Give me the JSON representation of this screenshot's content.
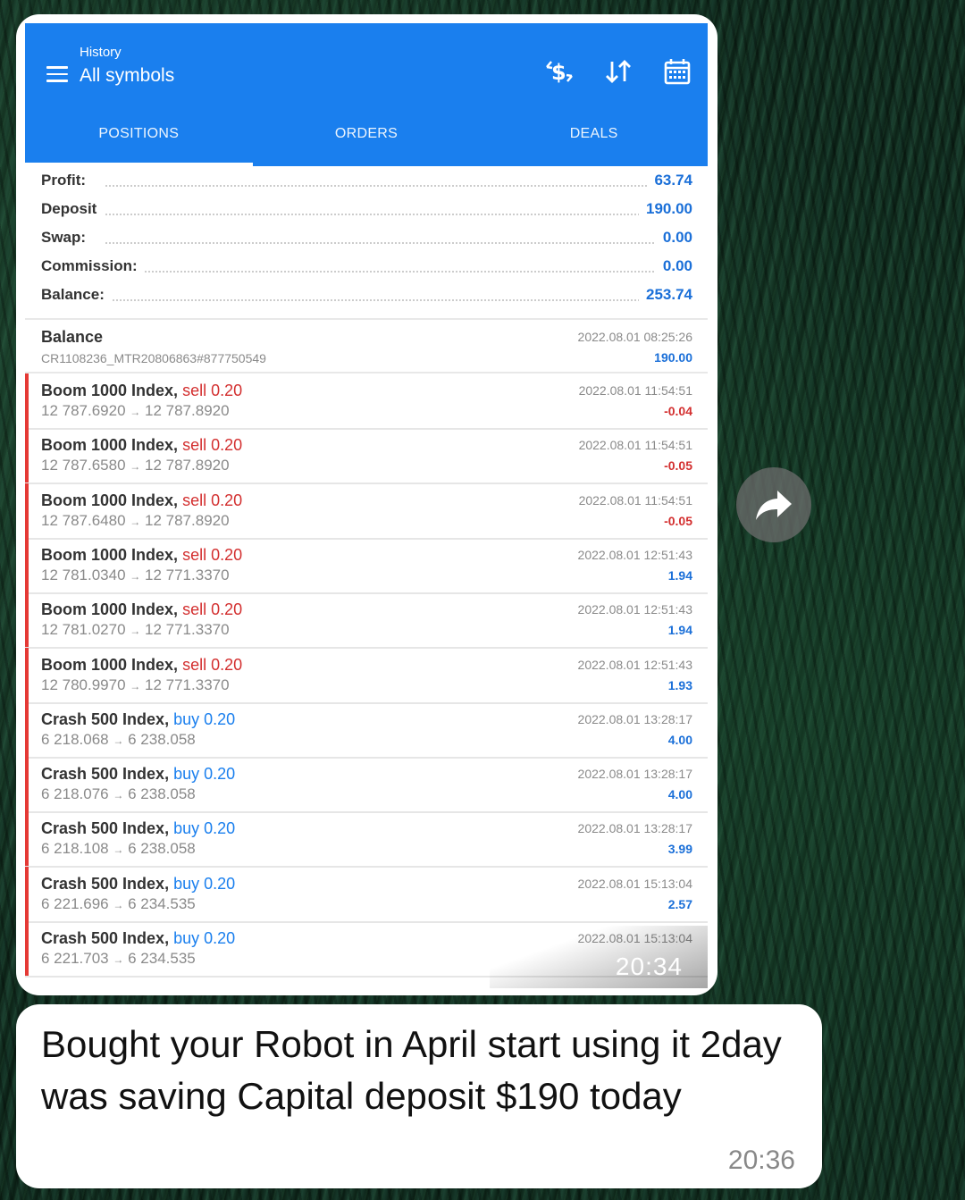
{
  "header": {
    "subtitle": "History",
    "title": "All symbols",
    "icons": [
      "currency-exchange-icon",
      "sort-icon",
      "calendar-icon"
    ]
  },
  "tabs": [
    {
      "label": "POSITIONS",
      "active": true
    },
    {
      "label": "ORDERS",
      "active": false
    },
    {
      "label": "DEALS",
      "active": false
    }
  ],
  "summary": [
    {
      "label": "Profit:",
      "value": "63.74"
    },
    {
      "label": "Deposit",
      "value": "190.00"
    },
    {
      "label": "Swap:",
      "value": "0.00"
    },
    {
      "label": "Commission:",
      "value": "0.00"
    },
    {
      "label": "Balance:",
      "value": "253.74"
    }
  ],
  "balance_entry": {
    "title": "Balance",
    "comment": "CR1108236_MTR20806863#877750549",
    "date": "2022.08.01 08:25:26",
    "value": "190.00"
  },
  "positions": [
    {
      "symbol": "Boom 1000 Index,",
      "side": "sell 0.20",
      "type": "sell",
      "open": "12 787.6920",
      "close": "12 787.8920",
      "date": "2022.08.01 11:54:51",
      "profit": "-0.04"
    },
    {
      "symbol": "Boom 1000 Index,",
      "side": "sell 0.20",
      "type": "sell",
      "open": "12 787.6580",
      "close": "12 787.8920",
      "date": "2022.08.01 11:54:51",
      "profit": "-0.05"
    },
    {
      "symbol": "Boom 1000 Index,",
      "side": "sell 0.20",
      "type": "sell",
      "open": "12 787.6480",
      "close": "12 787.8920",
      "date": "2022.08.01 11:54:51",
      "profit": "-0.05"
    },
    {
      "symbol": "Boom 1000 Index,",
      "side": "sell 0.20",
      "type": "sell",
      "open": "12 781.0340",
      "close": "12 771.3370",
      "date": "2022.08.01 12:51:43",
      "profit": "1.94"
    },
    {
      "symbol": "Boom 1000 Index,",
      "side": "sell 0.20",
      "type": "sell",
      "open": "12 781.0270",
      "close": "12 771.3370",
      "date": "2022.08.01 12:51:43",
      "profit": "1.94"
    },
    {
      "symbol": "Boom 1000 Index,",
      "side": "sell 0.20",
      "type": "sell",
      "open": "12 780.9970",
      "close": "12 771.3370",
      "date": "2022.08.01 12:51:43",
      "profit": "1.93"
    },
    {
      "symbol": "Crash 500 Index,",
      "side": "buy 0.20",
      "type": "buy",
      "open": "6 218.068",
      "close": "6 238.058",
      "date": "2022.08.01 13:28:17",
      "profit": "4.00"
    },
    {
      "symbol": "Crash 500 Index,",
      "side": "buy 0.20",
      "type": "buy",
      "open": "6 218.076",
      "close": "6 238.058",
      "date": "2022.08.01 13:28:17",
      "profit": "4.00"
    },
    {
      "symbol": "Crash 500 Index,",
      "side": "buy 0.20",
      "type": "buy",
      "open": "6 218.108",
      "close": "6 238.058",
      "date": "2022.08.01 13:28:17",
      "profit": "3.99"
    },
    {
      "symbol": "Crash 500 Index,",
      "side": "buy 0.20",
      "type": "buy",
      "open": "6 221.696",
      "close": "6 234.535",
      "date": "2022.08.01 15:13:04",
      "profit": "2.57"
    },
    {
      "symbol": "Crash 500 Index,",
      "side": "buy 0.20",
      "type": "buy",
      "open": "6 221.703",
      "close": "6 234.535",
      "date": "2022.08.01 15:13:04",
      "profit": ""
    }
  ],
  "chat": {
    "image_time": "20:34",
    "message": "Bought your Robot in April start using it 2day was saving  Capital deposit $190 today",
    "message_time": "20:36"
  },
  "colors": {
    "header_blue": "#1a7fee",
    "sell_red": "#d32f2f",
    "profit_blue": "#1a6fd8"
  }
}
